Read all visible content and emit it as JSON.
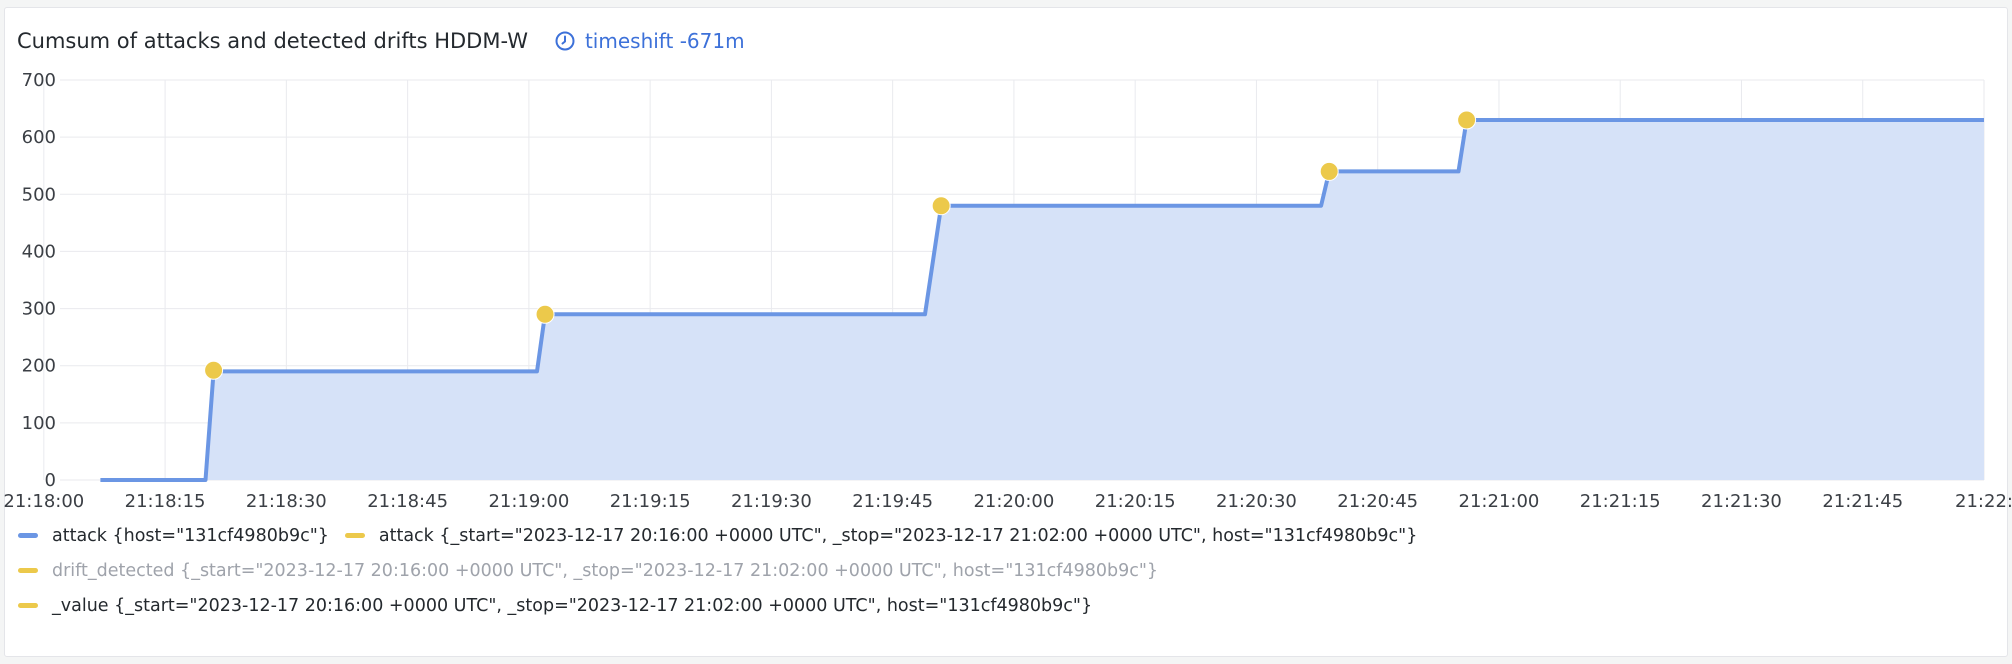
{
  "panel": {
    "title": "Cumsum of attacks and detected drifts HDDM-W",
    "timeshift": "timeshift -671m",
    "timeshift_icon": "clock-icon"
  },
  "colors": {
    "attack_line": "#6b96e4",
    "attack_fill": "#d6e2f8",
    "drift_marker": "#ecc94b",
    "accent": "#3d71d9"
  },
  "chart_data": {
    "type": "area",
    "title": "Cumsum of attacks and detected drifts HDDM-W",
    "xlabel": "",
    "ylabel": "",
    "ylim": [
      0,
      700
    ],
    "yticks": [
      0,
      100,
      200,
      300,
      400,
      500,
      600,
      700
    ],
    "xlim": [
      "21:18:02",
      "21:22:00"
    ],
    "xticks": [
      "21:18:00",
      "21:18:15",
      "21:18:30",
      "21:18:45",
      "21:19:00",
      "21:19:15",
      "21:19:30",
      "21:19:45",
      "21:20:00",
      "21:20:15",
      "21:20:30",
      "21:20:45",
      "21:21:00",
      "21:21:15",
      "21:21:30",
      "21:21:45",
      "21:22:"
    ],
    "grid": true,
    "legend_placement": "bottom",
    "series": [
      {
        "name": "attack {host=\"131cf4980b9c\"}",
        "kind": "area-step",
        "points": [
          {
            "x": "21:18:07",
            "y": 0
          },
          {
            "x": "21:18:20",
            "y": 0
          },
          {
            "x": "21:18:21",
            "y": 190
          },
          {
            "x": "21:19:01",
            "y": 190
          },
          {
            "x": "21:19:02",
            "y": 290
          },
          {
            "x": "21:19:49",
            "y": 290
          },
          {
            "x": "21:19:51",
            "y": 480
          },
          {
            "x": "21:20:38",
            "y": 480
          },
          {
            "x": "21:20:39",
            "y": 540
          },
          {
            "x": "21:20:55",
            "y": 540
          },
          {
            "x": "21:20:56",
            "y": 630
          },
          {
            "x": "21:22:00",
            "y": 630
          }
        ]
      },
      {
        "name": "attack {_start=\"2023-12-17 20:16:00 +0000 UTC\", _stop=\"2023-12-17 21:02:00 +0000 UTC\", host=\"131cf4980b9c\"}",
        "kind": "points",
        "points": [
          {
            "x": "21:18:21",
            "y": 192
          },
          {
            "x": "21:19:02",
            "y": 290
          },
          {
            "x": "21:19:51",
            "y": 480
          },
          {
            "x": "21:20:39",
            "y": 540
          },
          {
            "x": "21:20:56",
            "y": 630
          }
        ]
      }
    ]
  },
  "legend": {
    "rows": [
      [
        {
          "label": "attack {host=\"131cf4980b9c\"}",
          "color": "#6b96e4",
          "dim": false
        },
        {
          "label": "attack {_start=\"2023-12-17 20:16:00 +0000 UTC\", _stop=\"2023-12-17 21:02:00 +0000 UTC\", host=\"131cf4980b9c\"}",
          "color": "#ecc94b",
          "dim": false
        }
      ],
      [
        {
          "label": "drift_detected {_start=\"2023-12-17 20:16:00 +0000 UTC\", _stop=\"2023-12-17 21:02:00 +0000 UTC\", host=\"131cf4980b9c\"}",
          "color": "#ecc94b",
          "dim": true
        }
      ],
      [
        {
          "label": "_value {_start=\"2023-12-17 20:16:00 +0000 UTC\", _stop=\"2023-12-17 21:02:00 +0000 UTC\", host=\"131cf4980b9c\"}",
          "color": "#ecc94b",
          "dim": false
        }
      ]
    ]
  }
}
